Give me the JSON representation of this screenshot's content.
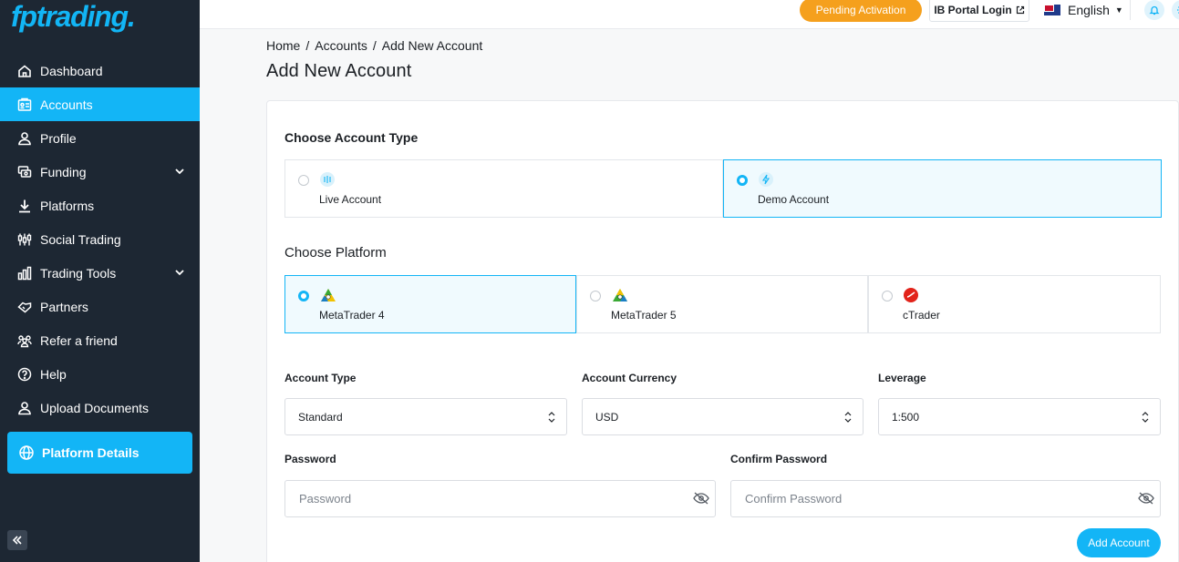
{
  "brand": {
    "logo": "fptrading",
    "logo_dot": "."
  },
  "sidebar": {
    "items": [
      {
        "label": "Dashboard",
        "icon": "home-icon"
      },
      {
        "label": "Accounts",
        "icon": "accounts-icon",
        "active": true
      },
      {
        "label": "Profile",
        "icon": "user-icon"
      },
      {
        "label": "Funding",
        "icon": "funding-icon",
        "has_submenu": true
      },
      {
        "label": "Platforms",
        "icon": "download-icon"
      },
      {
        "label": "Social Trading",
        "icon": "social-trading-icon"
      },
      {
        "label": "Trading Tools",
        "icon": "chart-icon",
        "has_submenu": true
      },
      {
        "label": "Partners",
        "icon": "handshake-icon"
      },
      {
        "label": "Refer a friend",
        "icon": "people-icon"
      },
      {
        "label": "Help",
        "icon": "help-icon"
      },
      {
        "label": "Upload Documents",
        "icon": "user-icon"
      }
    ],
    "platform_details": "Platform Details",
    "accent": "#13b5f6",
    "background": "#1d2733"
  },
  "topbar": {
    "pending": "Pending Activation",
    "ib_login": "IB Portal Login",
    "language": "English"
  },
  "breadcrumb": {
    "home": "Home",
    "accounts": "Accounts",
    "current": "Add New Account"
  },
  "page_title": "Add New Account",
  "account_type_section": {
    "title": "Choose Account Type",
    "options": [
      {
        "label": "Live Account",
        "selected": false
      },
      {
        "label": "Demo Account",
        "selected": true
      }
    ]
  },
  "platform_section": {
    "title": "Choose Platform",
    "options": [
      {
        "label": "MetaTrader 4",
        "selected": true
      },
      {
        "label": "MetaTrader 5",
        "selected": false
      },
      {
        "label": "cTrader",
        "selected": false
      }
    ]
  },
  "form": {
    "account_type_label": "Account Type",
    "account_type_value": "Standard",
    "currency_label": "Account Currency",
    "currency_value": "USD",
    "leverage_label": "Leverage",
    "leverage_value": "1:500",
    "password_label": "Password",
    "password_placeholder": "Password",
    "confirm_label": "Confirm Password",
    "confirm_placeholder": "Confirm Password",
    "submit": "Add Account"
  }
}
